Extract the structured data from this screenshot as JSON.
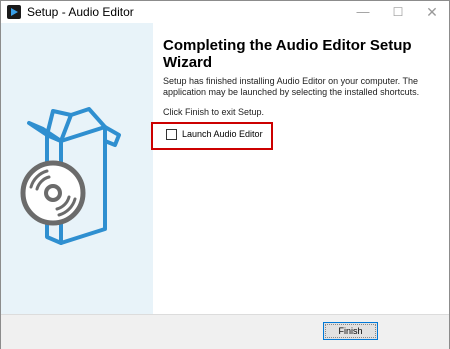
{
  "window": {
    "title": "Setup - Audio Editor",
    "app_icon": "dark-app-icon",
    "controls": {
      "minimize": "—",
      "maximize": "☐",
      "close": "✕"
    }
  },
  "main": {
    "heading": "Completing the Audio Editor Setup Wizard",
    "description": "Setup has finished installing Audio Editor on your computer. The application may be launched by selecting the installed shortcuts.",
    "instruction": "Click Finish to exit Setup.",
    "launch_checkbox": {
      "label": "Launch Audio Editor",
      "checked": false
    },
    "highlight_color": "#cc0000"
  },
  "footer": {
    "finish_label": "Finish"
  },
  "colors": {
    "left_panel": "#e8f3f9",
    "box_stroke": "#2f8fd0",
    "disc": "#6b6b6b"
  }
}
